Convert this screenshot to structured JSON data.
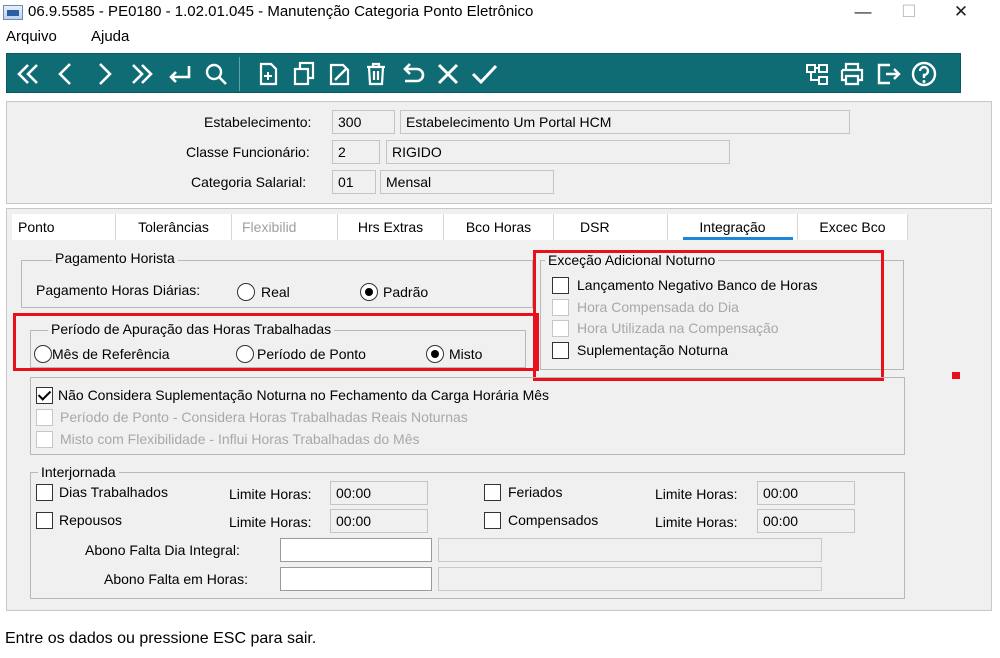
{
  "window": {
    "title": "06.9.5585 - PE0180 - 1.02.01.045 - Manutenção Categoria Ponto Eletrônico",
    "minimize": "—",
    "maximize": "☐",
    "close": "✕"
  },
  "menu": {
    "items": [
      "Arquivo",
      "Ajuda"
    ]
  },
  "toolbar": {
    "left_icons": [
      "first-icon",
      "previous-icon",
      "next-icon",
      "last-icon",
      "goto-icon",
      "search-icon",
      "new-icon",
      "copy-icon",
      "edit-icon",
      "delete-icon",
      "undo-icon",
      "cancel-icon",
      "confirm-icon"
    ],
    "right_icons": [
      "tree-icon",
      "print-icon",
      "exit-icon",
      "help-icon"
    ],
    "background": "#0f6c75"
  },
  "header": {
    "estabelecimento": {
      "label": "Estabelecimento:",
      "code": "300",
      "description": "Estabelecimento Um Portal HCM"
    },
    "classe": {
      "label": "Classe Funcionário:",
      "code": "2",
      "description": "RIGIDO"
    },
    "categoria": {
      "label": "Categoria Salarial:",
      "code": "01",
      "description": "Mensal"
    }
  },
  "tabs": [
    {
      "label": "Ponto",
      "state": "normal"
    },
    {
      "label": "Tolerâncias",
      "state": "normal"
    },
    {
      "label": "Flexibilid",
      "state": "disabled"
    },
    {
      "label": "Hrs Extras",
      "state": "normal"
    },
    {
      "label": "Bco Horas",
      "state": "normal"
    },
    {
      "label": "DSR",
      "state": "normal"
    },
    {
      "label": "Integração",
      "state": "active"
    },
    {
      "label": "Excec Bco",
      "state": "normal"
    }
  ],
  "pagamento": {
    "title": "Pagamento Horista",
    "label": "Pagamento Horas Diárias:",
    "options": [
      "Real",
      "Padrão"
    ],
    "selected": "Padrão"
  },
  "periodo": {
    "title": "Período de Apuração das Horas Trabalhadas",
    "options": [
      "Mês de Referência",
      "Período de Ponto",
      "Misto"
    ],
    "selected": "Misto"
  },
  "excecao": {
    "title": "Exceção Adicional Noturno",
    "items": [
      {
        "label": "Lançamento Negativo Banco de Horas",
        "checked": false,
        "enabled": true
      },
      {
        "label": "Hora Compensada do Dia",
        "checked": false,
        "enabled": false
      },
      {
        "label": "Hora Utilizada na Compensação",
        "checked": false,
        "enabled": false
      },
      {
        "label": "Suplementação Noturna",
        "checked": false,
        "enabled": true
      }
    ]
  },
  "suplementacao": {
    "items": [
      {
        "label": "Não Considera Suplementação Noturna no Fechamento da Carga Horária Mês",
        "checked": true,
        "enabled": true
      },
      {
        "label": "Período de Ponto - Considera Horas Trabalhadas Reais Noturnas",
        "checked": false,
        "enabled": false
      },
      {
        "label": "Misto com Flexibilidade - Influi Horas Trabalhadas do Mês",
        "checked": false,
        "enabled": false
      }
    ]
  },
  "interjornada": {
    "title": "Interjornada",
    "rows": [
      {
        "label": "Dias Trabalhados",
        "limit_label": "Limite Horas:",
        "limit": "00:00",
        "checked": false
      },
      {
        "label": "Feriados",
        "limit_label": "Limite Horas:",
        "limit": "00:00",
        "checked": false
      },
      {
        "label": "Repousos",
        "limit_label": "Limite Horas:",
        "limit": "00:00",
        "checked": false
      },
      {
        "label": "Compensados",
        "limit_label": "Limite Horas:",
        "limit": "00:00",
        "checked": false
      }
    ],
    "abono_integral_label": "Abono Falta Dia Integral:",
    "abono_integral_value": "",
    "abono_horas_label": "Abono Falta em Horas:",
    "abono_horas_value": ""
  },
  "status": {
    "text": "Entre os dados ou pressione ESC para sair."
  },
  "colors": {
    "highlight": "#e8101c",
    "tab_underline": "#1e86d8"
  }
}
